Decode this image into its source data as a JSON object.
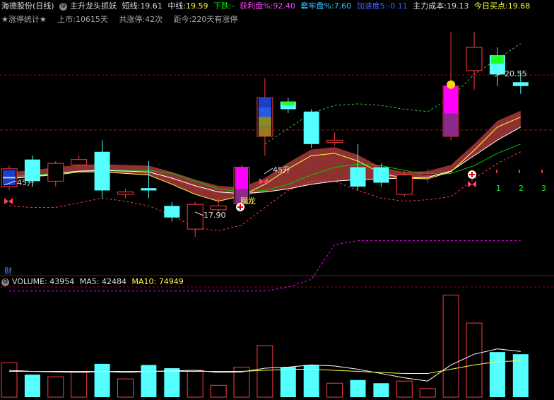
{
  "header": {
    "title": "海德股份(日线)",
    "indicator": "主升龙头抓妖",
    "short_label": "短线:",
    "short_value": "19.61",
    "mid_label": "中线:",
    "mid_value": "19.59",
    "down_label": "下跌:",
    "down_value": "-",
    "profit_label": "获利盘%:",
    "profit_value": "92.40",
    "trapped_label": "套牢盘%:",
    "trapped_value": "7.60",
    "accel_label": "加速度5:",
    "accel_value": "-0.11",
    "cost_label": "主力成本:",
    "cost_value": "19.13",
    "buy_label": "今日买点:",
    "buy_value": "19.68"
  },
  "subheader": {
    "stat_label": "★涨停统计★",
    "listed": "上市:10615天",
    "total_limit": "共涨停:42次",
    "since": "距今:220天有涨停"
  },
  "annotations": {
    "high_price": "20.55",
    "low_price": "17.90",
    "rise1": "45升",
    "rise2": "45升",
    "dragon": "飚龙",
    "count1": "1",
    "count2": "2",
    "count3": "3",
    "cai": "财"
  },
  "volume_header": {
    "volume_label": "VOLUME:",
    "volume_value": "43954",
    "ma5_label": "MA5:",
    "ma5_value": "42484",
    "ma10_label": "MA10:",
    "ma10_value": "74949"
  },
  "colors": {
    "up": "#ff3c3c",
    "down": "#54ffff",
    "ma_white": "#ffffff",
    "ma_yellow": "#ffff40",
    "green_line": "#00c800",
    "magenta": "#ff00ff",
    "ribbon": "#a83a3a",
    "dashed_white": "#aaaaaa"
  },
  "chart_data": [
    {
      "type": "candlestick",
      "title": "主升龙头抓妖",
      "candles": [
        {
          "o": 18.55,
          "c": 18.78,
          "h": 18.82,
          "l": 18.5,
          "dir": "up",
          "special": "bluebox"
        },
        {
          "o": 18.9,
          "c": 18.62,
          "h": 18.95,
          "l": 18.55,
          "dir": "down"
        },
        {
          "o": 18.62,
          "c": 18.85,
          "h": 18.88,
          "l": 18.55,
          "dir": "up"
        },
        {
          "o": 18.83,
          "c": 18.9,
          "h": 18.95,
          "l": 18.8,
          "dir": "up"
        },
        {
          "o": 19.0,
          "c": 18.5,
          "h": 19.15,
          "l": 18.4,
          "dir": "down"
        },
        {
          "o": 18.48,
          "c": 18.45,
          "h": 18.52,
          "l": 18.4,
          "dir": "up"
        },
        {
          "o": 18.53,
          "c": 18.5,
          "h": 18.88,
          "l": 18.4,
          "dir": "down"
        },
        {
          "o": 18.3,
          "c": 18.15,
          "h": 18.35,
          "l": 18.1,
          "dir": "down"
        },
        {
          "o": 18.0,
          "c": 18.32,
          "h": 18.35,
          "l": 17.9,
          "dir": "up"
        },
        {
          "o": 18.25,
          "c": 18.3,
          "h": 18.4,
          "l": 18.2,
          "dir": "up"
        },
        {
          "o": 18.33,
          "c": 18.8,
          "h": 18.83,
          "l": 18.3,
          "dir": "up",
          "special": "magenta"
        },
        {
          "o": 19.2,
          "c": 19.7,
          "h": 19.95,
          "l": 18.95,
          "dir": "up",
          "special": "stack"
        },
        {
          "o": 19.65,
          "c": 19.55,
          "h": 19.7,
          "l": 19.5,
          "dir": "down",
          "special": "greentop"
        },
        {
          "o": 19.52,
          "c": 19.1,
          "h": 19.55,
          "l": 19.05,
          "dir": "down"
        },
        {
          "o": 19.12,
          "c": 19.15,
          "h": 19.25,
          "l": 19.08,
          "dir": "up"
        },
        {
          "o": 18.8,
          "c": 18.55,
          "h": 19.1,
          "l": 18.5,
          "dir": "down"
        },
        {
          "o": 18.8,
          "c": 18.6,
          "h": 18.85,
          "l": 18.55,
          "dir": "down"
        },
        {
          "o": 18.45,
          "c": 18.7,
          "h": 18.75,
          "l": 18.42,
          "dir": "up"
        },
        {
          "o": 18.7,
          "c": 18.72,
          "h": 18.78,
          "l": 18.6,
          "dir": "up"
        },
        {
          "o": 19.2,
          "c": 19.85,
          "h": 20.55,
          "l": 19.15,
          "dir": "up",
          "special": "magenta_tall"
        },
        {
          "o": 20.05,
          "c": 20.35,
          "h": 20.55,
          "l": 19.8,
          "dir": "up"
        },
        {
          "o": 20.25,
          "c": 20.0,
          "h": 20.35,
          "l": 19.85,
          "dir": "down",
          "special": "greentop"
        },
        {
          "o": 19.9,
          "c": 19.85,
          "h": 20.05,
          "l": 19.75,
          "dir": "down"
        }
      ],
      "ma_short": [
        18.65,
        18.68,
        18.7,
        18.74,
        18.74,
        18.72,
        18.7,
        18.58,
        18.45,
        18.36,
        18.43,
        18.58,
        18.78,
        18.95,
        18.98,
        18.88,
        18.72,
        18.66,
        18.65,
        18.74,
        19.02,
        19.32,
        19.45
      ],
      "ma_white": [
        18.66,
        18.68,
        18.72,
        18.75,
        18.76,
        18.75,
        18.74,
        18.66,
        18.56,
        18.48,
        18.46,
        18.48,
        18.52,
        18.58,
        18.62,
        18.64,
        18.65,
        18.66,
        18.67,
        18.75,
        18.95,
        19.15,
        19.32
      ],
      "ma_green": [
        18.68,
        18.7,
        18.72,
        18.74,
        18.76,
        18.76,
        18.76,
        18.72,
        18.62,
        18.52,
        18.48,
        18.5,
        18.58,
        18.7,
        18.8,
        18.84,
        18.82,
        18.76,
        18.7,
        18.72,
        18.82,
        18.98,
        19.1
      ],
      "upper_dashed": [
        null,
        null,
        null,
        null,
        null,
        null,
        null,
        null,
        null,
        null,
        null,
        19.1,
        19.3,
        19.5,
        19.6,
        19.62,
        19.6,
        19.55,
        19.52,
        19.7,
        20.0,
        20.2,
        20.4
      ],
      "lower_red_dashed": [
        18.3,
        18.28,
        18.28,
        18.34,
        18.4,
        18.36,
        18.3,
        18.18,
        18.02,
        17.98,
        18.05,
        18.28,
        18.5,
        18.62,
        18.62,
        18.5,
        18.4,
        18.36,
        18.38,
        18.42,
        18.65,
        18.85,
        19.0
      ],
      "magenta_dashed": [
        17.2,
        17.2,
        17.2,
        17.2,
        17.2,
        17.2,
        17.2,
        17.2,
        17.2,
        17.2,
        17.2,
        17.2,
        17.25,
        17.35,
        17.8,
        17.85,
        17.85,
        17.85,
        17.85,
        17.85,
        17.85,
        17.85,
        17.85
      ],
      "support_level": 19.5,
      "annotations": [
        "20.55",
        "17.90",
        "45升",
        "飚龙"
      ]
    },
    {
      "type": "bar",
      "title": "VOLUME",
      "values": [
        32000,
        21000,
        19000,
        23000,
        31000,
        17000,
        30000,
        27000,
        25000,
        11000,
        28000,
        48000,
        28000,
        30000,
        13000,
        16000,
        13000,
        15000,
        8000,
        95000,
        69000,
        42000,
        40000
      ],
      "directions": [
        "up",
        "down",
        "up",
        "up",
        "down",
        "up",
        "down",
        "down",
        "up",
        "up",
        "up",
        "up",
        "down",
        "down",
        "up",
        "down",
        "down",
        "up",
        "up",
        "up",
        "up",
        "down",
        "down"
      ],
      "ma5": [
        25000,
        24000,
        23500,
        23000,
        24000,
        23000,
        24000,
        24500,
        25000,
        23000,
        23500,
        27000,
        28000,
        30000,
        29000,
        26000,
        22000,
        18000,
        15000,
        30000,
        40000,
        45000,
        42484
      ],
      "ma10": [
        24000,
        24000,
        24000,
        24000,
        24000,
        24000,
        24000,
        24000,
        24000,
        24000,
        24000,
        25000,
        26000,
        26000,
        25000,
        24000,
        23000,
        22000,
        22000,
        26000,
        30000,
        33000,
        34000
      ]
    }
  ]
}
